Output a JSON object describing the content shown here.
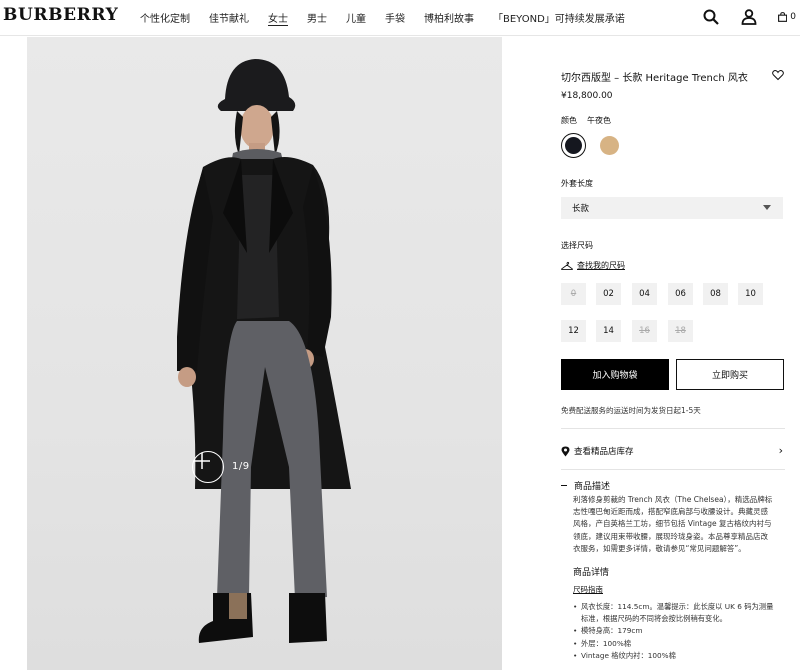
{
  "header": {
    "logo": "BURBERRY",
    "nav": [
      "个性化定制",
      "佳节献礼",
      "女士",
      "男士",
      "儿童",
      "手袋",
      "博柏利故事",
      "「BEYOND」可持续发展承诺"
    ],
    "active_nav": "女士",
    "icons": [
      "search-icon",
      "account-icon",
      "bag-icon"
    ],
    "bag_count": "0"
  },
  "gallery": {
    "counter": "1/9",
    "zoom_icon": "plus-icon"
  },
  "product": {
    "title": "切尔西版型 – 长款 Heritage Trench 风衣",
    "price": "¥18,800.00",
    "color_label": "颜色",
    "selected_color": "午夜色",
    "colors": [
      {
        "name": "午夜色",
        "hex": "#15171f"
      },
      {
        "name": "蜂蜜色",
        "hex": "#d7b384"
      }
    ],
    "length_label": "外套长度",
    "length_value": "长款",
    "size_label": "选择尺码",
    "size_guide": "查找我的尺码",
    "sizes": [
      {
        "label": "0",
        "available": false
      },
      {
        "label": "02",
        "available": true
      },
      {
        "label": "04",
        "available": true
      },
      {
        "label": "06",
        "available": true
      },
      {
        "label": "08",
        "available": true
      },
      {
        "label": "10",
        "available": true
      },
      {
        "label": "12",
        "available": true
      },
      {
        "label": "14",
        "available": true
      },
      {
        "label": "16",
        "available": false
      },
      {
        "label": "18",
        "available": false
      }
    ],
    "add_to_cart": "加入购物袋",
    "buy_now": "立即购买",
    "shipping_note": "免费配送服务的运送时间为发货日起1-5天",
    "store_stock": "查看精品店库存",
    "description_title": "商品描述",
    "description_lines": [
      "利落修身剪裁的 Trench 风衣（The Chelsea），精选品牌标",
      "志性嘎巴甸近距而成，搭配窄底肩部与收腰设计。典藏灵感",
      "风格，产自英格兰工坊，细节包括 Vintage 复古格纹内衬与",
      "领底，建议用束带收腰，展现玲珑身姿。本品尊享精品店改",
      "衣服务，如需更多详情，敬请参见“常见问题解答”。"
    ],
    "details_title": "商品详情",
    "fit_guide": "尺码指南",
    "details": [
      "风衣长度：114.5cm。温馨提示：此长度以 UK 6 码为测量",
      "标准，根据尺码的不同将会按比例稍有变化。",
      "模特身高：179cm",
      "外层：100%棉",
      "Vintage 格纹内衬：100%棉"
    ],
    "accent": "#000000"
  }
}
